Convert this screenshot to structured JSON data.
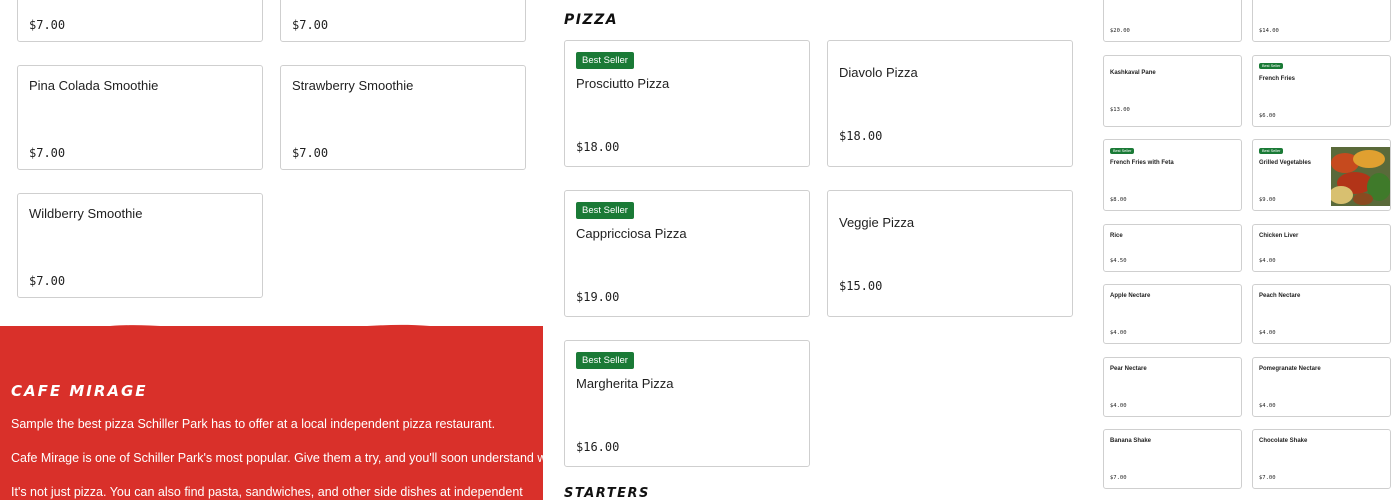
{
  "left": {
    "cards": [
      {
        "name": "",
        "price": "$7.00"
      },
      {
        "name": "",
        "price": "$7.00"
      },
      {
        "name": "Pina Colada Smoothie",
        "price": "$7.00"
      },
      {
        "name": "Strawberry Smoothie",
        "price": "$7.00"
      },
      {
        "name": "Wildberry Smoothie",
        "price": "$7.00"
      }
    ]
  },
  "cafe": {
    "title": "CAFE MIRAGE",
    "paragraphs": [
      "Sample the best pizza Schiller Park has to offer at a local independent pizza restaurant.",
      "Cafe Mirage is one of Schiller Park's most popular. Give them a try, and you'll soon understand why.",
      "It's not just pizza. You can also find pasta, sandwiches, and other side dishes at independent"
    ],
    "bg_color": "#d9302a"
  },
  "middle": {
    "section_title": "PIZZA",
    "badge_label": "Best Seller",
    "cards": [
      {
        "name": "Prosciutto Pizza",
        "price": "$18.00",
        "best_seller": true
      },
      {
        "name": "Diavolo Pizza",
        "price": "$18.00",
        "best_seller": false
      },
      {
        "name": "Cappricciosa Pizza",
        "price": "$19.00",
        "best_seller": true
      },
      {
        "name": "Veggie Pizza",
        "price": "$15.00",
        "best_seller": false
      },
      {
        "name": "Margherita Pizza",
        "price": "$16.00",
        "best_seller": true
      }
    ],
    "next_section_title": "STARTERS"
  },
  "right": {
    "badge_label": "Best Seller",
    "cards": [
      {
        "name": "",
        "price": "$20.00",
        "best_seller": false
      },
      {
        "name": "",
        "price": "$14.00",
        "best_seller": false
      },
      {
        "name": "Kashkaval Pane",
        "price": "$13.00",
        "best_seller": false
      },
      {
        "name": "French Fries",
        "price": "$6.00",
        "best_seller": true
      },
      {
        "name": "French Fries with Feta",
        "price": "$8.00",
        "best_seller": true
      },
      {
        "name": "Grilled Vegetables",
        "price": "$9.00",
        "best_seller": true,
        "has_image": true
      },
      {
        "name": "Rice",
        "price": "$4.50",
        "best_seller": false
      },
      {
        "name": "Chicken Liver",
        "price": "$4.00",
        "best_seller": false
      },
      {
        "name": "Apple Nectare",
        "price": "$4.00",
        "best_seller": false
      },
      {
        "name": "Peach Nectare",
        "price": "$4.00",
        "best_seller": false
      },
      {
        "name": "Pear Nectare",
        "price": "$4.00",
        "best_seller": false
      },
      {
        "name": "Pomegranate Nectare",
        "price": "$4.00",
        "best_seller": false
      },
      {
        "name": "Banana Shake",
        "price": "$7.00",
        "best_seller": false
      },
      {
        "name": "Chocolate Shake",
        "price": "$7.00",
        "best_seller": false
      }
    ]
  },
  "colors": {
    "accent_red": "#d9302a",
    "badge_green": "#1a7a36",
    "card_border": "#cfcfcf"
  }
}
